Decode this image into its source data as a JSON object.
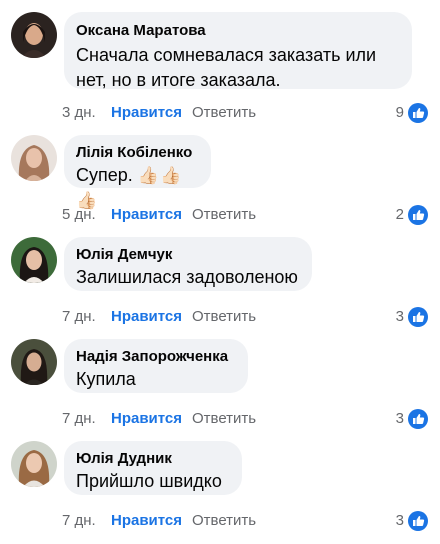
{
  "comments": [
    {
      "name": "Оксана Маратова",
      "text": "Сначала сомневалася заказать или нет, но в итоге заказала.",
      "time": "3 дн.",
      "like": "Нравится",
      "reply": "Ответить",
      "count": "9"
    },
    {
      "name": "Лілія Кобіленко",
      "text": "Супер.",
      "emoji": "👍🏻👍🏻👍🏻",
      "time": "5 дн.",
      "like": "Нравится",
      "reply": "Ответить",
      "count": "2"
    },
    {
      "name": "Юлія Демчук",
      "text": "Залишилася задоволеною",
      "time": "7 дн.",
      "like": "Нравится",
      "reply": "Ответить",
      "count": "3"
    },
    {
      "name": "Надія Запорожченка",
      "text": "Купила",
      "time": "7 дн.",
      "like": "Нравится",
      "reply": "Ответить",
      "count": "3"
    },
    {
      "name": "Юлія Дудник",
      "text": "Прийшло швидко",
      "time": "7 дн.",
      "like": "Нравится",
      "reply": "Ответить",
      "count": "3"
    }
  ],
  "colors": {
    "like_blue": "#1b74e4",
    "bubble": "#f0f2f5",
    "meta": "#65676b"
  },
  "icons": {
    "reaction": "like-thumb-icon"
  }
}
